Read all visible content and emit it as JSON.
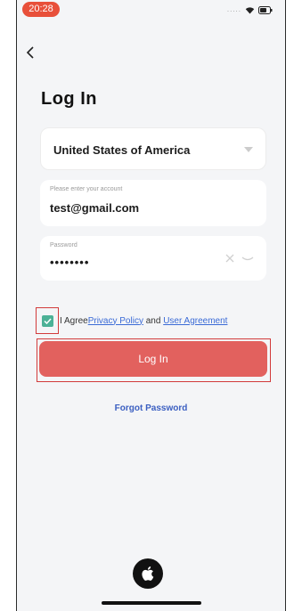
{
  "status_bar": {
    "time": "20:28"
  },
  "title": "Log In",
  "country": {
    "value": "United States of America"
  },
  "account": {
    "label": "Please enter your account",
    "value": "test@gmail.com"
  },
  "password": {
    "label": "Password",
    "value": "••••••••"
  },
  "agreement": {
    "checked": true,
    "prefix": "I Agree",
    "privacy_link": "Privacy Policy",
    "conjunction": " and ",
    "user_agreement_link": "User Agreement"
  },
  "login_button": {
    "label": "Log In"
  },
  "forgot_password": "Forgot Password",
  "colors": {
    "time_pill": "#e8503a",
    "primary_button": "#e2615e",
    "checkbox": "#4cb196",
    "link": "#3a6ad6",
    "highlight_box": "#d23b3b"
  },
  "icons": {
    "back": "chevron-left-icon",
    "dropdown": "caret-down-icon",
    "clear": "close-icon",
    "eye": "eye-closed-icon",
    "sign_in": "apple-logo-icon"
  }
}
